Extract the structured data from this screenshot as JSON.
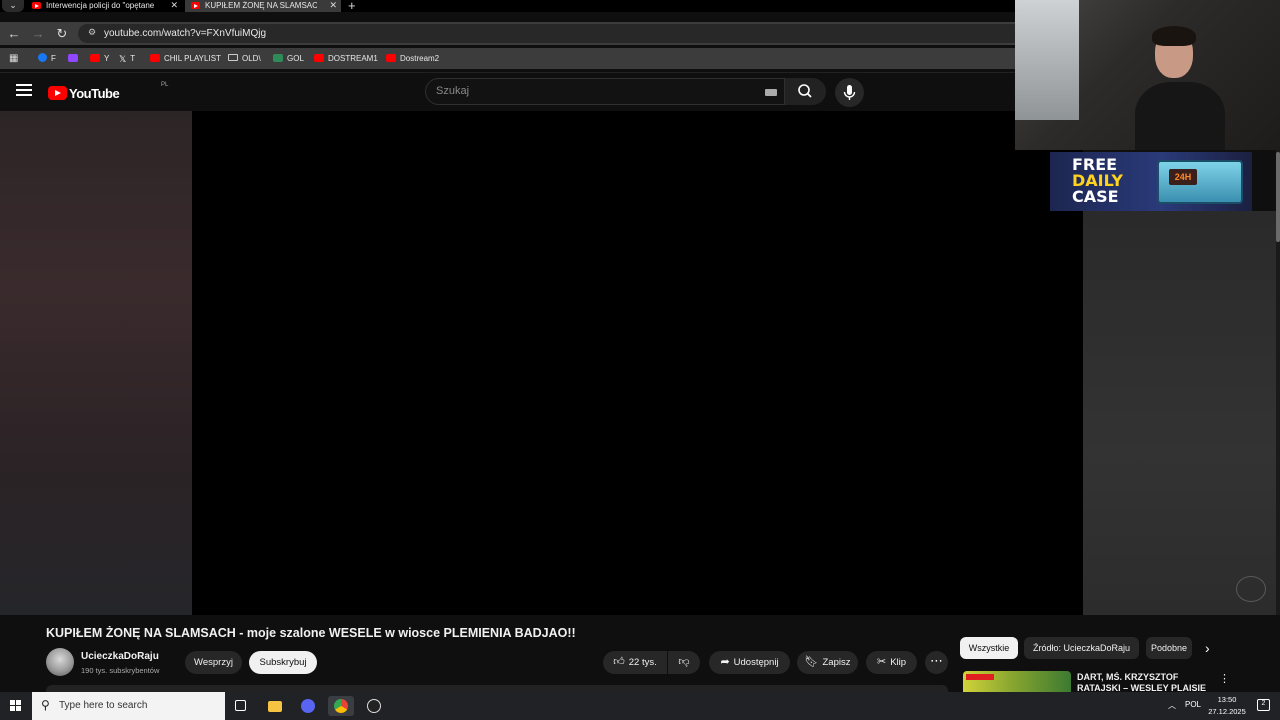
{
  "browser": {
    "tabs": [
      {
        "title": "Interwencja policji do \"opętane",
        "active": false
      },
      {
        "title": "KUPIŁEM ŻONĘ NA SLAMSACH",
        "active": true
      }
    ],
    "url": "youtube.com/watch?v=FXnVfuiMQjg",
    "bookmarks": [
      {
        "label": "F",
        "icon": "facebook-icon"
      },
      {
        "label": "",
        "icon": "twitch-icon"
      },
      {
        "label": "Y",
        "icon": "youtube-icon"
      },
      {
        "label": "T",
        "icon": "x-icon"
      },
      {
        "label": "CHIL PLAYLIST",
        "icon": "youtube-icon"
      },
      {
        "label": "OLD\\",
        "icon": "folder-icon"
      },
      {
        "label": "GOL",
        "icon": "gol-icon"
      },
      {
        "label": "DOSTREAM1",
        "icon": "youtube-icon"
      },
      {
        "label": "Dostream2",
        "icon": "youtube-icon"
      }
    ]
  },
  "youtube": {
    "logo_text": "YouTube",
    "country_code": "PL",
    "search_placeholder": "Szukaj",
    "video": {
      "title": "KUPIŁEM ŻONĘ NA SLAMSACH - moje szalone WESELE w wiosce PLEMIENIA BADJAO!!",
      "channel": "UcieczkaDoRaju",
      "subscribers": "190 tys. subskrybentów",
      "support_label": "Wesprzyj",
      "subscribe_label": "Subskrybuj",
      "likes": "22 tys.",
      "share_label": "Udostępnij",
      "save_label": "Zapisz",
      "clip_label": "Klip"
    },
    "chips": [
      "Wszystkie",
      "Źródło: UcieczkaDoRaju",
      "Podobne"
    ],
    "recommendation": {
      "title": "DART, MŚ. KRZYSZTOF RATAJSKI – WESLEY PLAISIE"
    }
  },
  "overlay_ad": {
    "line1": "FREE",
    "line2": "DAILY",
    "line3": "CASE",
    "badge": "24H"
  },
  "taskbar": {
    "search_placeholder": "Type here to search",
    "language": "POL",
    "time": "13:50",
    "date": "27.12.2025",
    "notification_count": "2"
  },
  "colors": {
    "youtube_red": "#ff0000",
    "page_bg": "#0f0f0f",
    "pill_bg": "#272727"
  }
}
